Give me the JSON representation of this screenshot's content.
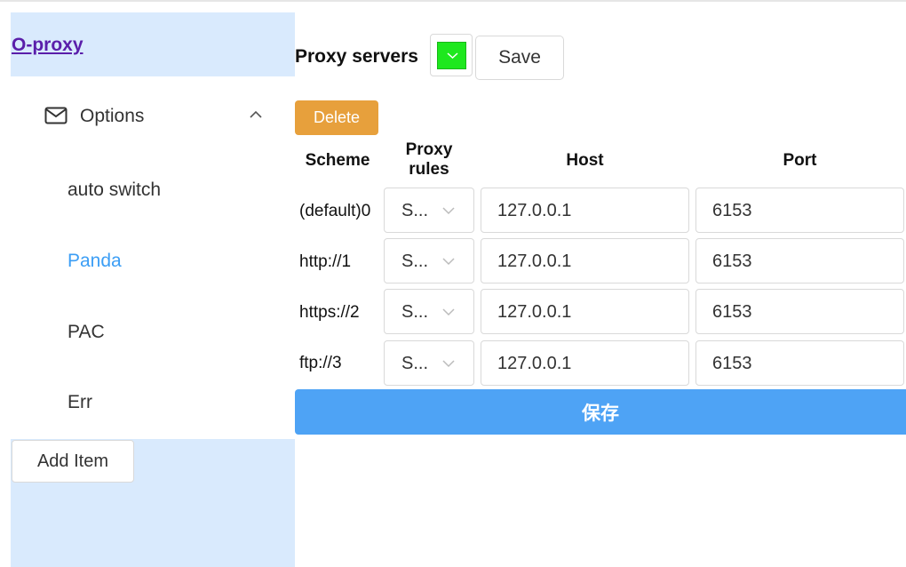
{
  "sidebar": {
    "brand": "O-proxy",
    "submenu": {
      "label": "Options",
      "icon": "mail-icon",
      "expanded": true
    },
    "items": [
      {
        "label": "auto switch",
        "active": false
      },
      {
        "label": "Panda",
        "active": true
      },
      {
        "label": "PAC",
        "active": false
      },
      {
        "label": "Err",
        "active": false
      }
    ],
    "add_item_label": "Add Item"
  },
  "main": {
    "title": "Proxy servers",
    "color_swatch": "#1ee81e",
    "save_label": "Save",
    "delete_label": "Delete",
    "headers": {
      "scheme": "Scheme",
      "proxy_rules": "Proxy rules",
      "host": "Host",
      "port": "Port"
    },
    "rows": [
      {
        "scheme": "(default)0",
        "rule": "S...",
        "host": "127.0.0.1",
        "port": "6153"
      },
      {
        "scheme": "http://1",
        "rule": "S...",
        "host": "127.0.0.1",
        "port": "6153"
      },
      {
        "scheme": "https://2",
        "rule": "S...",
        "host": "127.0.0.1",
        "port": "6153"
      },
      {
        "scheme": "ftp://3",
        "rule": "S...",
        "host": "127.0.0.1",
        "port": "6153"
      }
    ],
    "submit_label": "保存"
  },
  "colors": {
    "accent": "#4ea3f5",
    "delete": "#e7a03c",
    "active_text": "#3c9ef5",
    "sidebar_bg": "#d9eafd"
  }
}
